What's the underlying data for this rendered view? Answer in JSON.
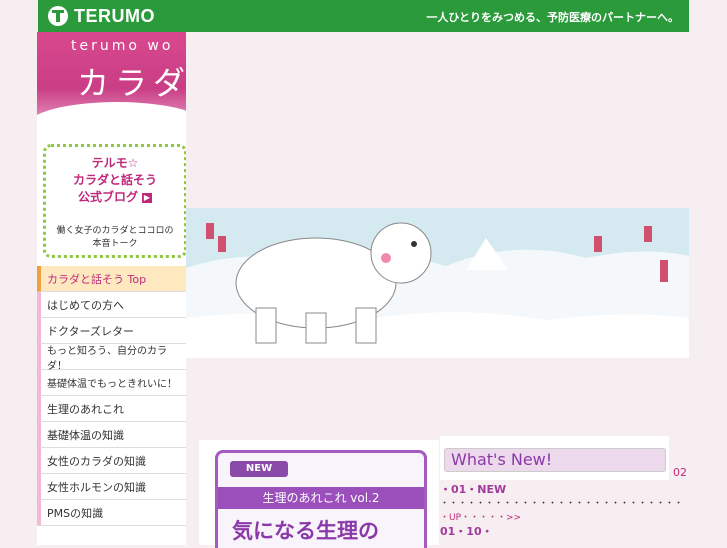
{
  "header": {
    "logo_text": "TERUMO",
    "tagline": "一人ひとりをみつめる、予防医療のパートナーへ。"
  },
  "banner": {
    "sub_title": "terumo wo",
    "main_title": "カラダ"
  },
  "blog": {
    "title_line1": "テルモ☆",
    "title_line2": "カラダと話そう",
    "title_line3": "公式ブログ",
    "desc_line1": "働く女子のカラダとココロの",
    "desc_line2": "本音トーク"
  },
  "nav": {
    "items": [
      {
        "label": "カラダと話そう Top"
      },
      {
        "label": "はじめての方へ"
      },
      {
        "label": "ドクターズレター"
      },
      {
        "label": "もっと知ろう、自分のカラダ！"
      },
      {
        "label": "基礎体温でもっときれいに！"
      },
      {
        "label": "生理のあれこれ"
      },
      {
        "label": "基礎体温の知識"
      },
      {
        "label": "女性のカラダの知識"
      },
      {
        "label": "女性ホルモンの知識"
      },
      {
        "label": "PMSの知識"
      }
    ]
  },
  "feature": {
    "badge": "NEW",
    "title": "生理のあれこれ vol.2",
    "headline": "気になる生理の"
  },
  "whatsnew": {
    "heading": "What's New!",
    "side_number": "02"
  },
  "news": [
    {
      "date": "・01・NEW",
      "text": "・・・・・・・・・・・・・・・・・・・・・・・・・・・",
      "more": "・UP・・・・・>>"
    },
    {
      "date": "01・10・"
    }
  ],
  "colors": {
    "brand_green": "#2a9a3a",
    "accent_pink": "#c0287a",
    "accent_purple": "#9b4fba"
  }
}
